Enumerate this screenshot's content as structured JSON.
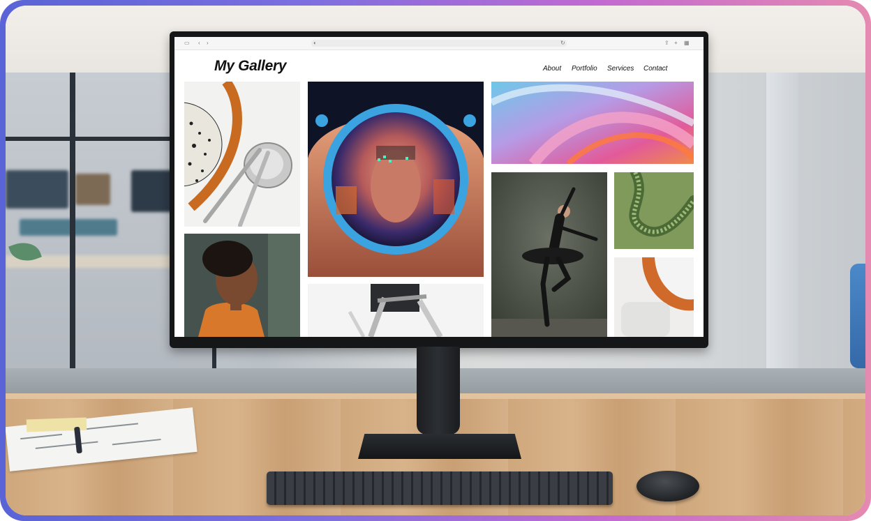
{
  "site": {
    "title": "My Gallery",
    "nav": [
      "About",
      "Portfolio",
      "Services",
      "Contact"
    ]
  },
  "icons": {
    "browser_left": [
      "sidebar-icon",
      "back-icon",
      "forward-icon"
    ],
    "browser_url": [
      "shield-icon",
      "reload-icon"
    ],
    "browser_right": [
      "share-icon",
      "new-tab-icon",
      "tabs-overview-icon"
    ]
  },
  "gallery_tiles": [
    "cutlery-tile",
    "astronaut-tile",
    "abstract-rings-tile",
    "portrait-tile",
    "ballerina-tile",
    "green-ribbon-tile",
    "silver-chair-tile",
    "orange-curve-tile"
  ],
  "colors": {
    "frame_gradient_start": "#5a64d6",
    "frame_gradient_end": "#e58ab0",
    "monitor": "#141618",
    "desk": "#d5b088"
  }
}
